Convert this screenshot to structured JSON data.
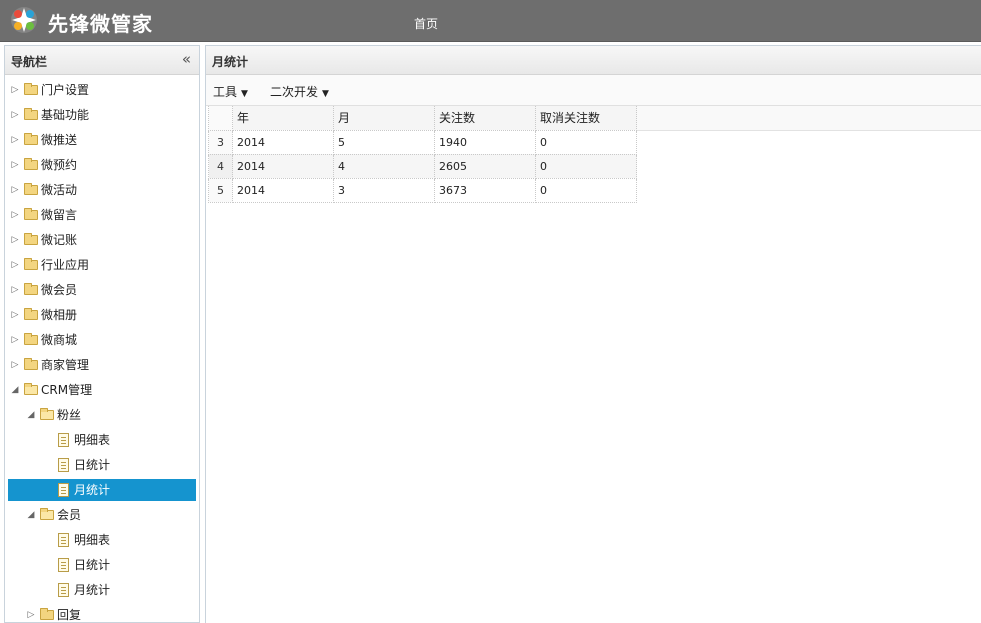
{
  "app": {
    "title": "先锋微管家",
    "home_link": "首页"
  },
  "sidebar": {
    "title": "导航栏",
    "collapse_icon": "«",
    "items": [
      {
        "label": "门户设置",
        "level": 0,
        "type": "folder",
        "expanded": false
      },
      {
        "label": "基础功能",
        "level": 0,
        "type": "folder",
        "expanded": false
      },
      {
        "label": "微推送",
        "level": 0,
        "type": "folder",
        "expanded": false
      },
      {
        "label": "微预约",
        "level": 0,
        "type": "folder",
        "expanded": false
      },
      {
        "label": "微活动",
        "level": 0,
        "type": "folder",
        "expanded": false
      },
      {
        "label": "微留言",
        "level": 0,
        "type": "folder",
        "expanded": false
      },
      {
        "label": "微记账",
        "level": 0,
        "type": "folder",
        "expanded": false
      },
      {
        "label": "行业应用",
        "level": 0,
        "type": "folder",
        "expanded": false
      },
      {
        "label": "微会员",
        "level": 0,
        "type": "folder",
        "expanded": false
      },
      {
        "label": "微相册",
        "level": 0,
        "type": "folder",
        "expanded": false
      },
      {
        "label": "微商城",
        "level": 0,
        "type": "folder",
        "expanded": false
      },
      {
        "label": "商家管理",
        "level": 0,
        "type": "folder",
        "expanded": false
      },
      {
        "label": "CRM管理",
        "level": 0,
        "type": "folder",
        "expanded": true
      },
      {
        "label": "粉丝",
        "level": 1,
        "type": "folder",
        "expanded": true
      },
      {
        "label": "明细表",
        "level": 2,
        "type": "file"
      },
      {
        "label": "日统计",
        "level": 2,
        "type": "file"
      },
      {
        "label": "月统计",
        "level": 2,
        "type": "file",
        "selected": true
      },
      {
        "label": "会员",
        "level": 1,
        "type": "folder",
        "expanded": true
      },
      {
        "label": "明细表",
        "level": 2,
        "type": "file"
      },
      {
        "label": "日统计",
        "level": 2,
        "type": "file"
      },
      {
        "label": "月统计",
        "level": 2,
        "type": "file"
      },
      {
        "label": "回复",
        "level": 1,
        "type": "folder",
        "expanded": false
      }
    ]
  },
  "content": {
    "title": "月统计",
    "toolbar": {
      "tools_label": "工具",
      "dev_label": "二次开发"
    },
    "table": {
      "columns": [
        "年",
        "月",
        "关注数",
        "取消关注数"
      ],
      "rows": [
        {
          "num": "3",
          "cells": [
            "2014",
            "5",
            "1940",
            "0"
          ]
        },
        {
          "num": "4",
          "cells": [
            "2014",
            "4",
            "2605",
            "0"
          ]
        },
        {
          "num": "5",
          "cells": [
            "2014",
            "3",
            "3673",
            "0"
          ]
        }
      ]
    }
  },
  "colors": {
    "topbar": "#6e6e6e",
    "selected": "#1594cf"
  }
}
